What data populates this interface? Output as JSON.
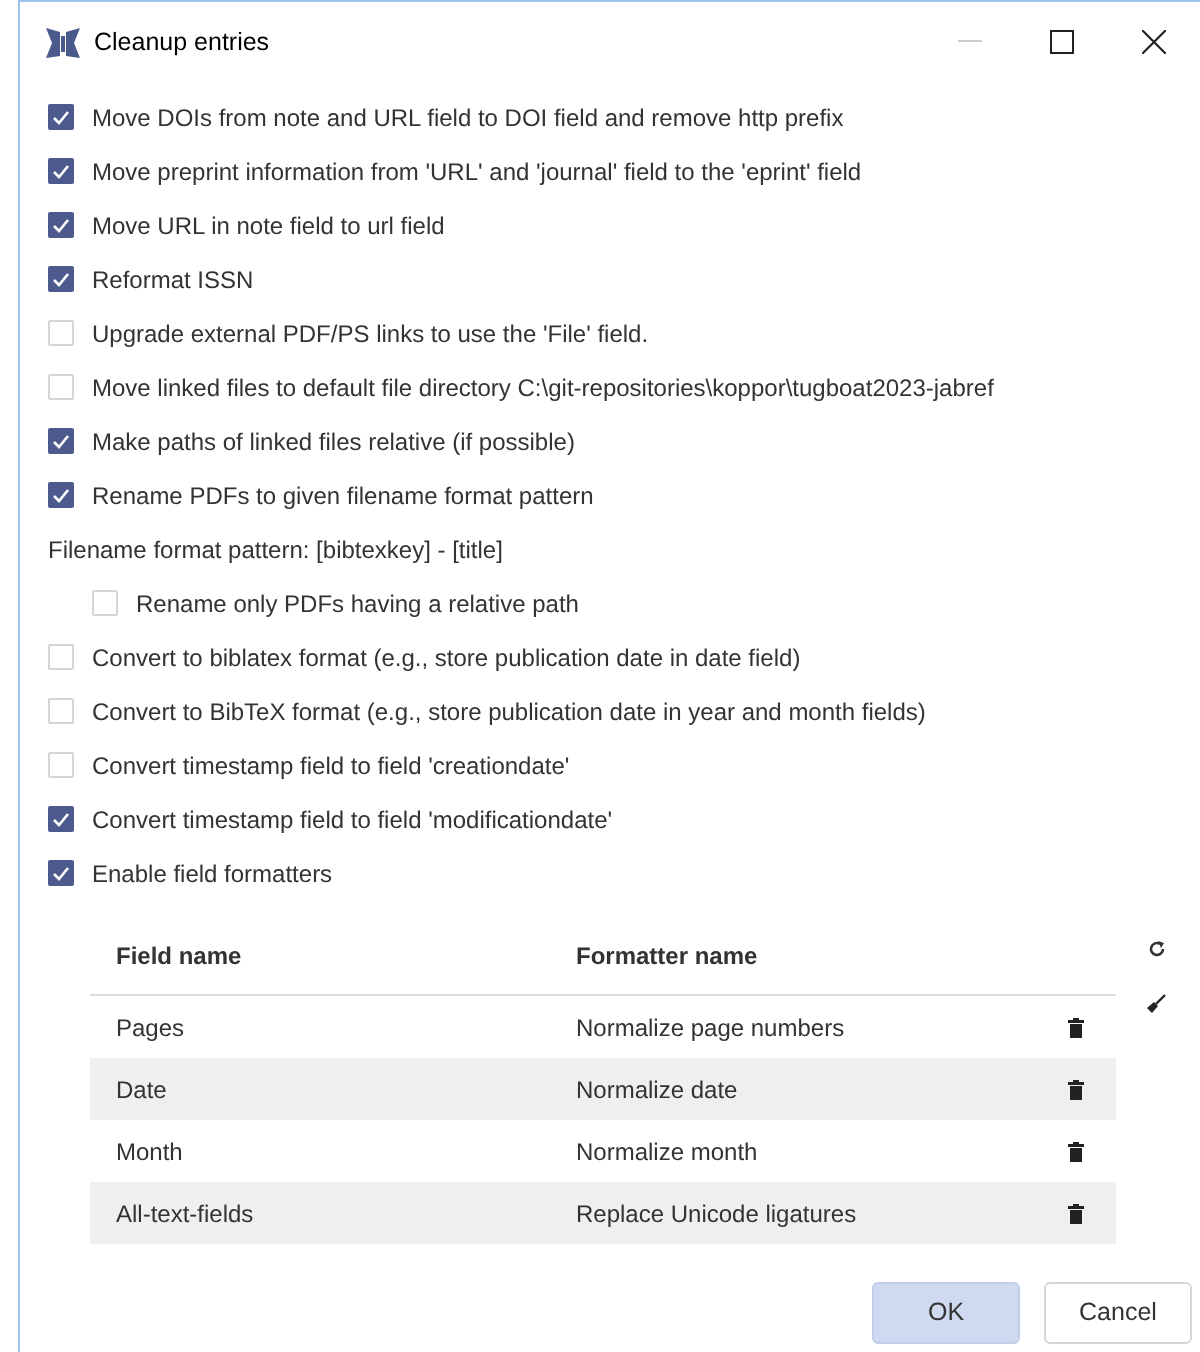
{
  "window": {
    "title": "Cleanup entries"
  },
  "options": [
    {
      "kind": "checkbox",
      "label": "Move DOIs from note and URL field to DOI field and remove http prefix",
      "checked": true
    },
    {
      "kind": "checkbox",
      "label": "Move preprint information from 'URL' and 'journal' field to the 'eprint' field",
      "checked": true
    },
    {
      "kind": "checkbox",
      "label": "Move URL in note field to url field",
      "checked": true
    },
    {
      "kind": "checkbox",
      "label": "Reformat ISSN",
      "checked": true
    },
    {
      "kind": "checkbox",
      "label": "Upgrade external PDF/PS links to use the 'File' field.",
      "checked": false
    },
    {
      "kind": "checkbox",
      "label": "Move linked files to default file directory C:\\git-repositories\\koppor\\tugboat2023-jabref",
      "checked": false
    },
    {
      "kind": "checkbox",
      "label": "Make paths of linked files relative (if possible)",
      "checked": true
    },
    {
      "kind": "checkbox",
      "label": "Rename PDFs to given filename format pattern",
      "checked": true,
      "children": [
        {
          "kind": "text",
          "label": "Filename format pattern: [bibtexkey] - [title]"
        },
        {
          "kind": "checkbox",
          "label": "Rename only PDFs having a relative path",
          "checked": false,
          "indented": true
        }
      ]
    },
    {
      "kind": "checkbox",
      "label": "Convert to biblatex format (e.g., store publication date in date field)",
      "checked": false
    },
    {
      "kind": "checkbox",
      "label": "Convert to BibTeX format (e.g., store publication date in year and month fields)",
      "checked": false
    },
    {
      "kind": "checkbox",
      "label": "Convert timestamp field to field 'creationdate'",
      "checked": false
    },
    {
      "kind": "checkbox",
      "label": "Convert timestamp field to field 'modificationdate'",
      "checked": true
    },
    {
      "kind": "checkbox",
      "label": "Enable field formatters",
      "checked": true
    }
  ],
  "formatters": {
    "columns": [
      "Field name",
      "Formatter name"
    ],
    "rows": [
      {
        "field": "Pages",
        "formatter": "Normalize page numbers"
      },
      {
        "field": "Date",
        "formatter": "Normalize date"
      },
      {
        "field": "Month",
        "formatter": "Normalize month"
      },
      {
        "field": "All-text-fields",
        "formatter": "Replace Unicode ligatures"
      }
    ]
  },
  "buttons": [
    {
      "label": "OK",
      "kind": "primary"
    },
    {
      "label": "Cancel",
      "kind": "secondary"
    }
  ]
}
